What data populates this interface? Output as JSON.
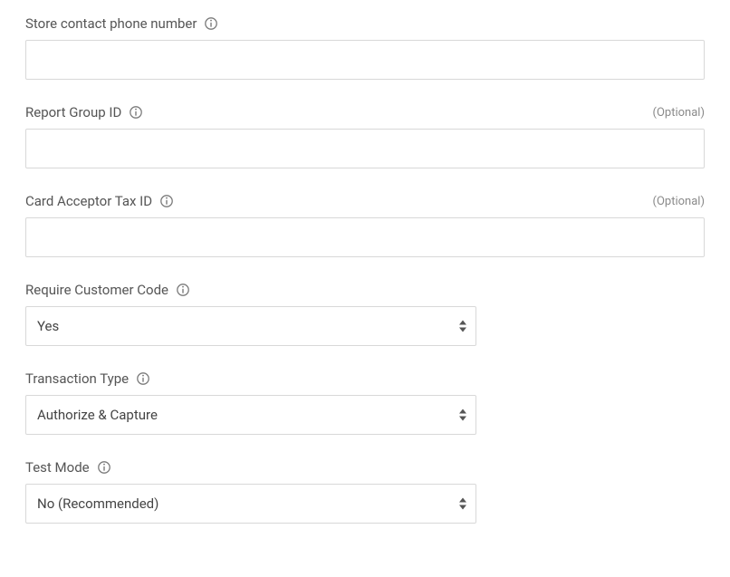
{
  "fields": {
    "phone": {
      "label": "Store contact phone number",
      "value": ""
    },
    "reportGroup": {
      "label": "Report Group ID",
      "value": "",
      "optional": "(Optional)"
    },
    "cardAcceptorTaxId": {
      "label": "Card Acceptor Tax ID",
      "value": "",
      "optional": "(Optional)"
    },
    "requireCustomerCode": {
      "label": "Require Customer Code",
      "selected": "Yes"
    },
    "transactionType": {
      "label": "Transaction Type",
      "selected": "Authorize & Capture"
    },
    "testMode": {
      "label": "Test Mode",
      "selected": "No (Recommended)"
    }
  }
}
